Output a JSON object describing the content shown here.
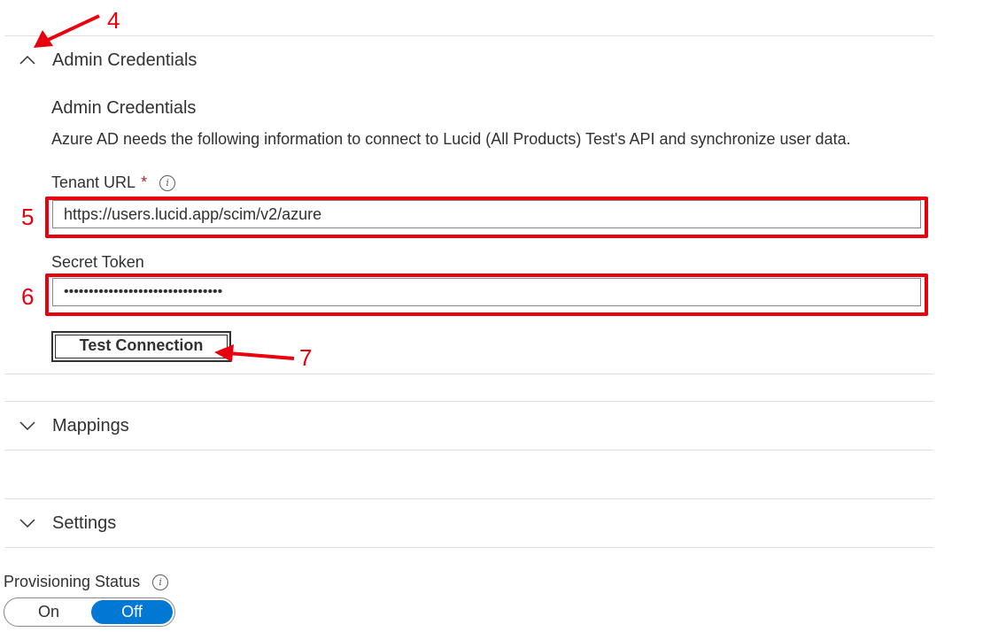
{
  "annotations": {
    "callout_4": "4",
    "callout_5": "5",
    "callout_6": "6",
    "callout_7": "7",
    "color": "#e8000e"
  },
  "admin_section": {
    "header_title": "Admin Credentials",
    "expanded": true,
    "subtitle": "Admin Credentials",
    "description": "Azure AD needs the following information to connect to Lucid (All Products) Test's API and synchronize user data.",
    "tenant_url_label": "Tenant URL",
    "required_marker": "*",
    "tenant_url_value": "https://users.lucid.app/scim/v2/azure",
    "secret_token_label": "Secret Token",
    "secret_token_value": "••••••••••••••••••••••••••••••••",
    "test_button_label": "Test Connection"
  },
  "mappings_section": {
    "header_title": "Mappings",
    "expanded": false
  },
  "settings_section": {
    "header_title": "Settings",
    "expanded": false
  },
  "provisioning": {
    "label": "Provisioning Status",
    "on_label": "On",
    "off_label": "Off",
    "selected": "Off",
    "accent_color": "#0078d4"
  },
  "icons": {
    "info": "info-icon",
    "chevron_up": "chevron-up-icon",
    "chevron_down": "chevron-down-icon"
  }
}
